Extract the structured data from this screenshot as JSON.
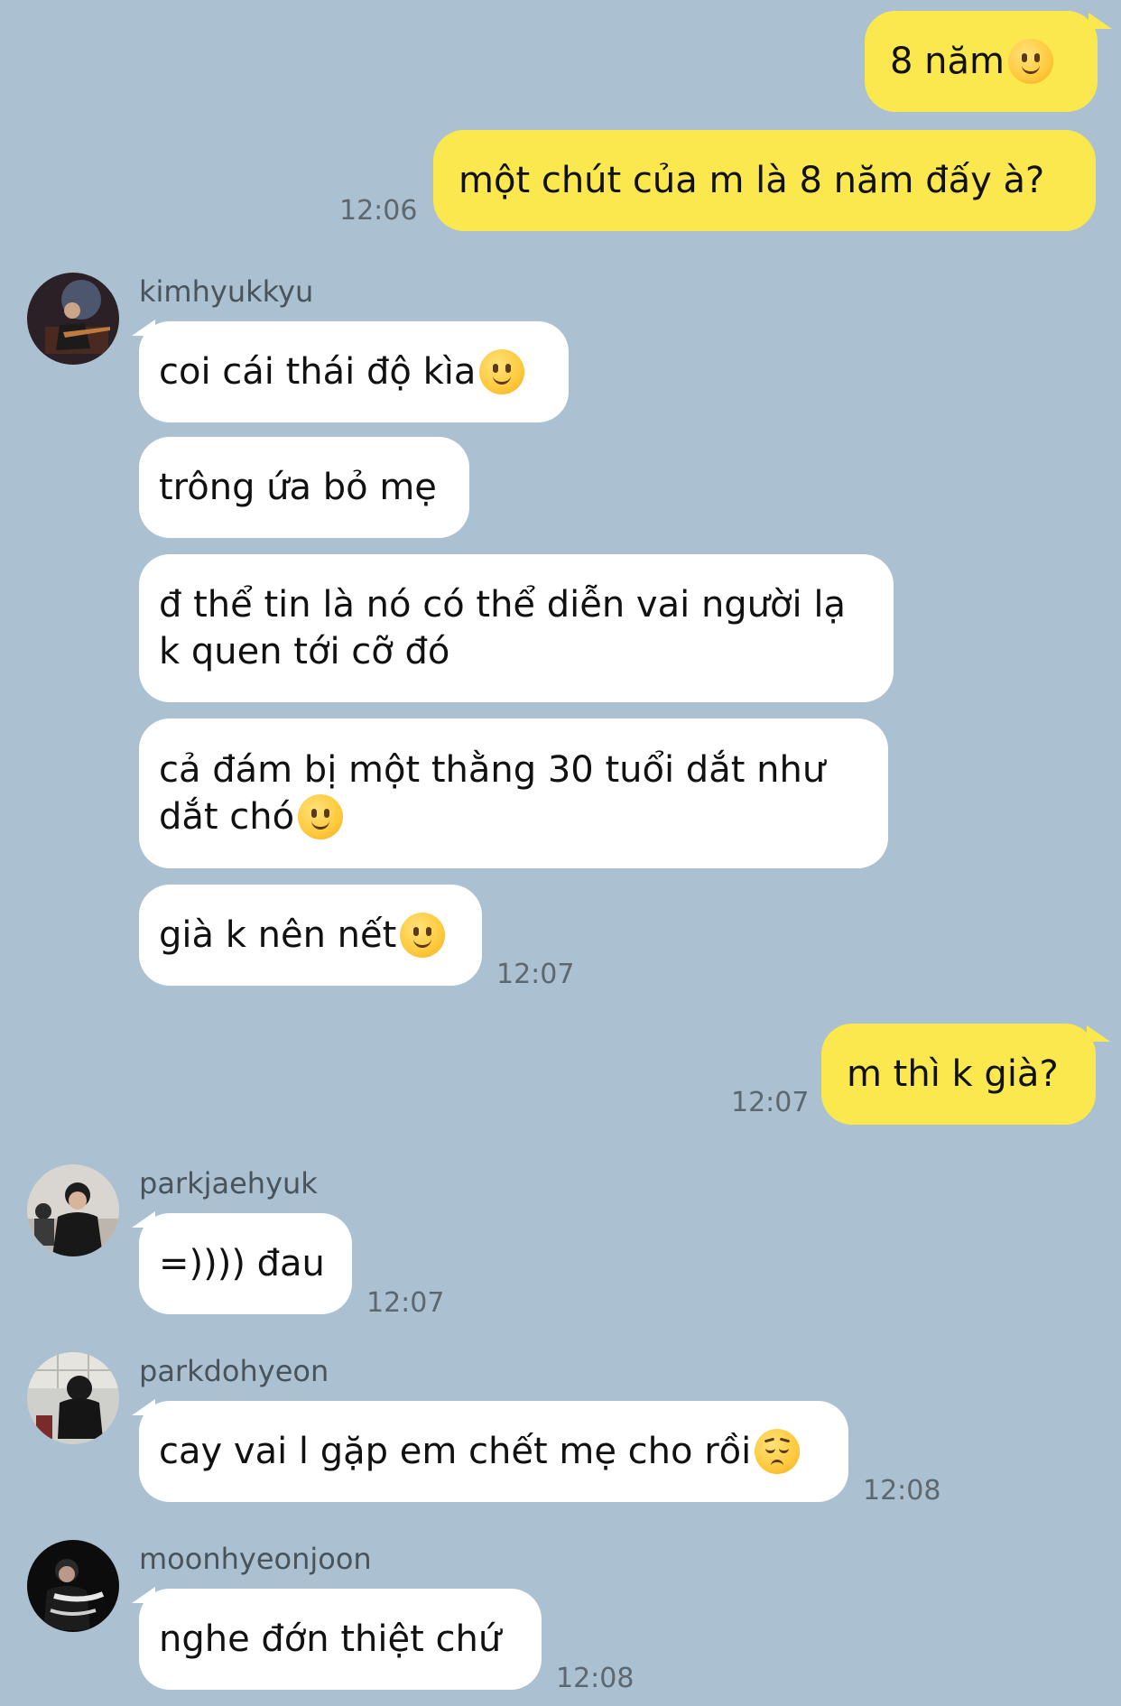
{
  "messages": {
    "m1": {
      "text": "8 năm"
    },
    "m2": {
      "text": "một chút của m là 8 năm đấy à?",
      "time": "12:06"
    },
    "g1": {
      "sender": "kimhyukkyu",
      "b1": "coi cái thái độ kìa",
      "b2": "trông ứa bỏ mẹ",
      "b3_line1": "đ thể tin là nó có thể diễn vai người lạ",
      "b3_line2": "k quen tới cỡ đó",
      "b4_line1": "cả đám bị một thằng 30 tuổi dắt như",
      "b4_line2": "dắt chó",
      "b5": "già k nên nết",
      "time": "12:07"
    },
    "m3": {
      "text": "m thì k già?",
      "time": "12:07"
    },
    "g2": {
      "sender": "parkjaehyuk",
      "text": "=)))) đau",
      "time": "12:07"
    },
    "g3": {
      "sender": "parkdohyeon",
      "text": "cay vai l gặp em chết mẹ cho rồi",
      "time": "12:08"
    },
    "g4": {
      "sender": "moonhyeonjoon",
      "text": "nghe đớn thiệt chứ",
      "time": "12:08"
    }
  },
  "emojis": {
    "slight_smile": "slightly-smiling-face-icon",
    "pensive": "pensive-face-icon"
  },
  "colors": {
    "background": "#abc1d1",
    "my_bubble": "#fae84e",
    "their_bubble": "#ffffff",
    "timestamp": "#5d6770",
    "sender_name": "#49535b"
  }
}
